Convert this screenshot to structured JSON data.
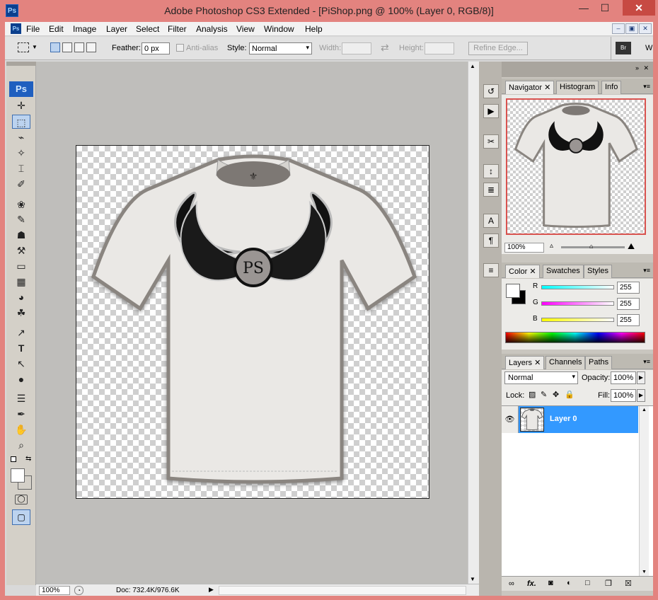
{
  "window": {
    "title": "Adobe Photoshop CS3 Extended - [PiShop.png @ 100% (Layer 0, RGB/8)]",
    "app_icon": "Ps",
    "minimize": "—",
    "maximize": "☐",
    "close": "✕"
  },
  "menu": {
    "items": [
      "File",
      "Edit",
      "Image",
      "Layer",
      "Select",
      "Filter",
      "Analysis",
      "View",
      "Window",
      "Help"
    ],
    "mdi_min": "–",
    "mdi_restore": "▣",
    "mdi_close": "✕"
  },
  "options": {
    "feather_label": "Feather:",
    "feather_value": "0 px",
    "antialias_label": "Anti-alias",
    "style_label": "Style:",
    "style_value": "Normal",
    "width_label": "Width:",
    "height_label": "Height:",
    "refine_edge": "Refine Edge...",
    "swap_icon": "⇄",
    "extra": "W"
  },
  "toolbox": {
    "logo": "Ps",
    "tools": [
      "✛",
      "⬚",
      "⌁",
      "✧",
      "⌶",
      "✐",
      "❀",
      "✎",
      "☗",
      "⚒",
      "▭",
      "▦",
      "◕",
      "☘",
      "↗",
      "T",
      "↖",
      "●",
      "☰",
      "✒",
      "✋",
      "⌕"
    ]
  },
  "status": {
    "zoom": "100%",
    "doc": "Doc: 732.4K/976.6K"
  },
  "dock": {
    "buttons": [
      "↺",
      "▶",
      "✂",
      "↕",
      "≣",
      "A",
      "¶",
      "≡"
    ]
  },
  "navigator": {
    "tabs": [
      "Navigator",
      "Histogram",
      "Info"
    ],
    "zoom": "100%"
  },
  "color": {
    "tabs": [
      "Color",
      "Swatches",
      "Styles"
    ],
    "r_label": "R",
    "g_label": "G",
    "b_label": "B",
    "r": "255",
    "g": "255",
    "b": "255",
    "foreground": "#ffffff",
    "background": "#000000"
  },
  "layers": {
    "tabs": [
      "Layers",
      "Channels",
      "Paths"
    ],
    "blend_mode": "Normal",
    "opacity_label": "Opacity:",
    "opacity": "100%",
    "lock_label": "Lock:",
    "fill_label": "Fill:",
    "fill": "100%",
    "rows": [
      {
        "name": "Layer 0",
        "selected": true
      }
    ],
    "bottom_icons": [
      "∞",
      "fx.",
      "◙",
      "◐",
      "□",
      "❐",
      "☒"
    ]
  },
  "artwork": {
    "logo_text": "PS"
  },
  "colors": {
    "title_bar": "#e3837f",
    "selection_blue": "#3399ff"
  }
}
